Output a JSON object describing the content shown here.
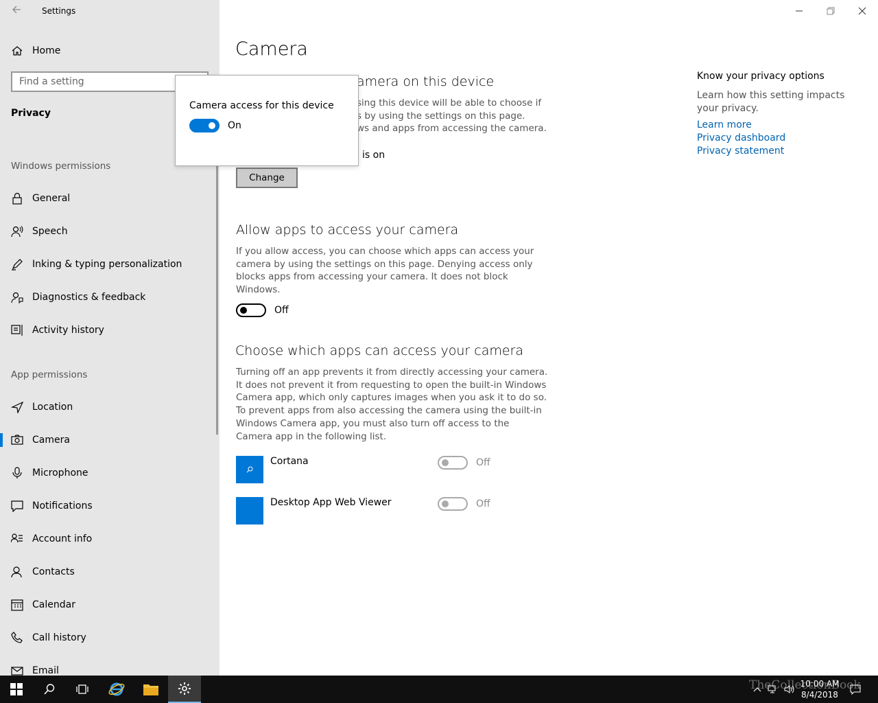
{
  "window": {
    "title": "Settings",
    "controls": {
      "minimize": "—",
      "maximize": "❐",
      "close": "✕"
    }
  },
  "sidebar": {
    "home_label": "Home",
    "search_placeholder": "Find a setting",
    "current_section": "Privacy",
    "windows_permissions_label": "Windows permissions",
    "windows_permissions": [
      {
        "label": "General",
        "icon": "lock-icon"
      },
      {
        "label": "Speech",
        "icon": "speech-icon"
      },
      {
        "label": "Inking & typing personalization",
        "icon": "inking-icon"
      },
      {
        "label": "Diagnostics & feedback",
        "icon": "diagnostics-icon"
      },
      {
        "label": "Activity history",
        "icon": "activity-history-icon"
      }
    ],
    "app_permissions_label": "App permissions",
    "app_permissions": [
      {
        "label": "Location",
        "icon": "location-icon"
      },
      {
        "label": "Camera",
        "icon": "camera-icon",
        "selected": true
      },
      {
        "label": "Microphone",
        "icon": "microphone-icon"
      },
      {
        "label": "Notifications",
        "icon": "notifications-icon"
      },
      {
        "label": "Account info",
        "icon": "account-info-icon"
      },
      {
        "label": "Contacts",
        "icon": "contacts-icon"
      },
      {
        "label": "Calendar",
        "icon": "calendar-icon"
      },
      {
        "label": "Call history",
        "icon": "call-history-icon"
      },
      {
        "label": "Email",
        "icon": "email-icon"
      }
    ]
  },
  "main": {
    "page_title": "Camera",
    "section1": {
      "heading_partial": "amera on this device",
      "para_lines": [
        "sing this device will be able to choose if",
        "s by using the settings on this page.",
        "ws and apps from accessing the camera."
      ],
      "status_partial": "is on",
      "change_button": "Change"
    },
    "section2": {
      "heading": "Allow apps to access your camera",
      "para": "If you allow access, you can choose which apps can access your camera by using the settings on this page. Denying access only blocks apps from accessing your camera. It does not block Windows.",
      "toggle_label": "Off",
      "toggle_state": false
    },
    "section3": {
      "heading": "Choose which apps can access your camera",
      "para": "Turning off an app prevents it from directly accessing your camera. It does not prevent it from requesting to open the built-in Windows Camera app, which only captures images when you ask it to do so. To prevent apps from also accessing the camera using the built-in Windows Camera app, you must also turn off access to the Camera app in the following list.",
      "apps": [
        {
          "name": "Cortana",
          "toggle_label": "Off",
          "enabled": false
        },
        {
          "name": "Desktop App Web Viewer",
          "toggle_label": "Off",
          "enabled": false
        }
      ]
    }
  },
  "right_panel": {
    "title": "Know your privacy options",
    "text": "Learn how this setting impacts your privacy.",
    "links": [
      "Learn more",
      "Privacy dashboard",
      "Privacy statement"
    ]
  },
  "popup": {
    "title": "Camera access for this device",
    "toggle_label": "On",
    "toggle_state": true
  },
  "taskbar": {
    "time": "10:00 AM",
    "date": "8/4/2018",
    "watermark": "TheCollectionBook"
  },
  "colors": {
    "accent": "#0078d7",
    "sidebar_bg": "#e6e6e6",
    "link": "#0063b1",
    "taskbar_bg": "#101010"
  }
}
